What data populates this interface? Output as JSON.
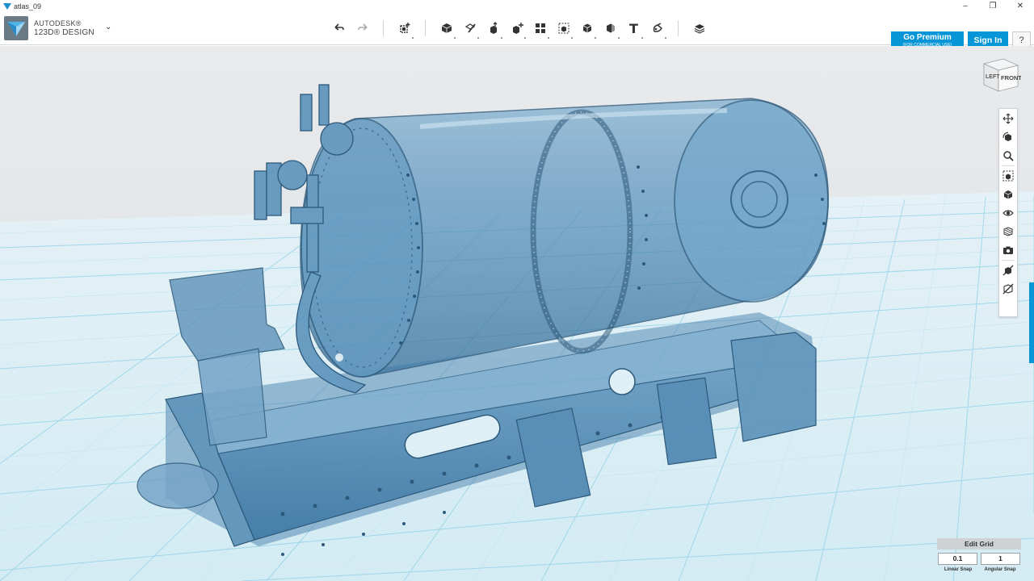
{
  "window": {
    "title": "atlas_09",
    "controls": {
      "minimize": "–",
      "maximize": "❐",
      "close": "✕"
    }
  },
  "brand": {
    "line1": "AUTODESK®",
    "line2": "123D® DESIGN",
    "menu_chevron": "⌄"
  },
  "toolbar": {
    "tools": [
      {
        "name": "undo-icon",
        "group": 0
      },
      {
        "name": "redo-icon",
        "group": 0
      },
      {
        "name": "transform-icon",
        "group": 1
      },
      {
        "name": "primitives-icon",
        "group": 2
      },
      {
        "name": "sketch-icon",
        "group": 2
      },
      {
        "name": "construct-icon",
        "group": 2
      },
      {
        "name": "modify-icon",
        "group": 2
      },
      {
        "name": "pattern-icon",
        "group": 2
      },
      {
        "name": "grouping-icon",
        "group": 2
      },
      {
        "name": "combine-icon",
        "group": 2
      },
      {
        "name": "measure-icon",
        "group": 2
      },
      {
        "name": "text-icon",
        "group": 2,
        "glyph": "T"
      },
      {
        "name": "snap-icon",
        "group": 2
      },
      {
        "name": "material-icon",
        "group": 3
      }
    ],
    "go_premium": "Go Premium",
    "go_premium_sub": "(FOR COMMERCIAL USE)",
    "sign_in": "Sign In",
    "help": "?"
  },
  "viewcube": {
    "left_face": "LEFT",
    "front_face": "FRONT"
  },
  "navbar": {
    "items": [
      "pan-icon",
      "orbit-icon",
      "zoom-icon",
      "fit-icon",
      "view-icon",
      "visibility-icon",
      "material-display-icon",
      "screenshot-icon",
      "hide-sketch-icon",
      "hide-mesh-icon"
    ]
  },
  "grid_panel": {
    "edit_grid": "Edit Grid",
    "linear_snap_value": "0.1",
    "angular_snap_value": "1",
    "linear_snap_label": "Linear Snap",
    "angular_snap_label": "Angular Snap"
  },
  "colors": {
    "accent": "#0696d7",
    "viewport_sky": "#e3e6e8",
    "grid_floor": "#dceef4",
    "grid_line": "#7cc8e3",
    "model_fill": "#3d7fae"
  }
}
